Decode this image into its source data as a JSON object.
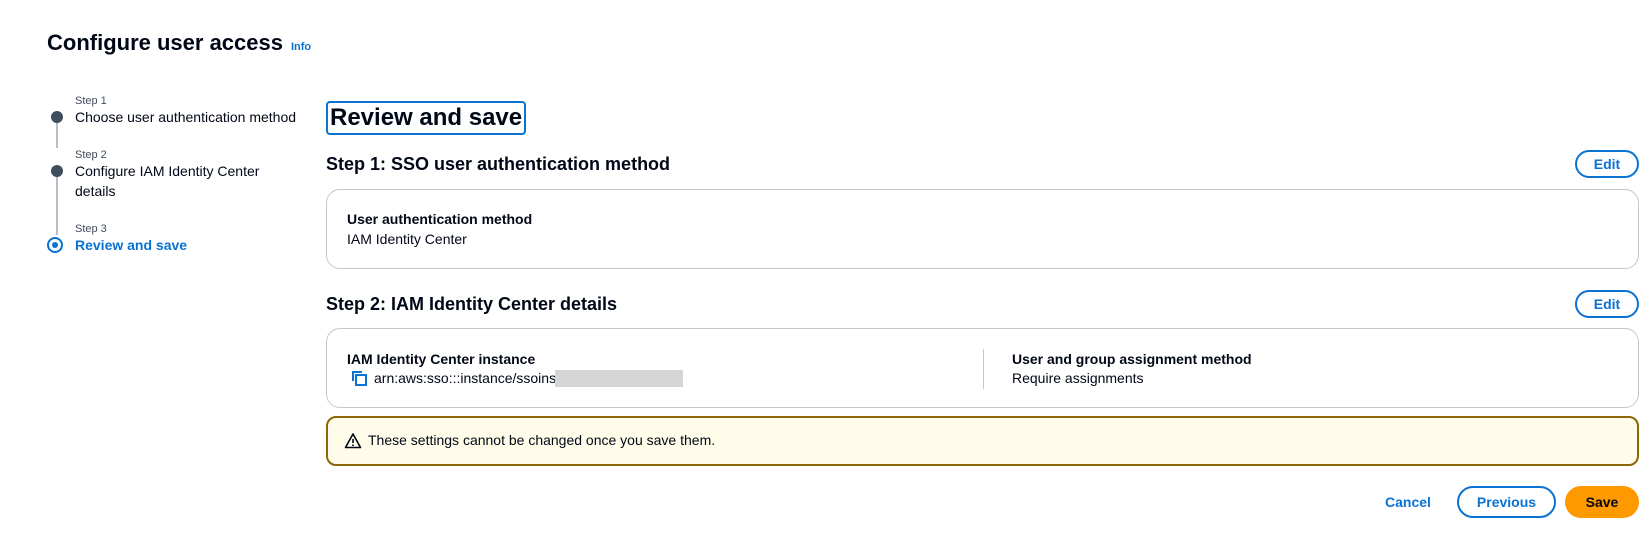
{
  "page": {
    "title": "Configure user access",
    "info_label": "Info"
  },
  "stepper": {
    "steps": [
      {
        "number": "Step 1",
        "label": "Choose user authentication method",
        "state": "complete"
      },
      {
        "number": "Step 2",
        "label": "Configure IAM Identity Center details",
        "state": "complete"
      },
      {
        "number": "Step 3",
        "label": "Review and save",
        "state": "active"
      }
    ]
  },
  "review": {
    "title": "Review and save",
    "section1": {
      "heading": "Step 1: SSO user authentication method",
      "edit_label": "Edit",
      "fields": [
        {
          "label": "User authentication method",
          "value": "IAM Identity Center"
        }
      ]
    },
    "section2": {
      "heading": "Step 2: IAM Identity Center details",
      "edit_label": "Edit",
      "fields": [
        {
          "label": "IAM Identity Center instance",
          "value": "arn:aws:sso:::instance/ssoins-",
          "icon": "copy-icon",
          "redacted": true
        },
        {
          "label": "User and group assignment method",
          "value": "Require assignments"
        }
      ]
    },
    "alert": {
      "icon": "warning-icon",
      "text": "These settings cannot be changed once you save them.",
      "border_color": "#8d6605",
      "background": "#fffce9"
    }
  },
  "actions": {
    "cancel_label": "Cancel",
    "previous_label": "Previous",
    "save_label": "Save"
  },
  "colors": {
    "accent": "#0972d3",
    "primary_button": "#ff9900",
    "text": "#000716"
  }
}
